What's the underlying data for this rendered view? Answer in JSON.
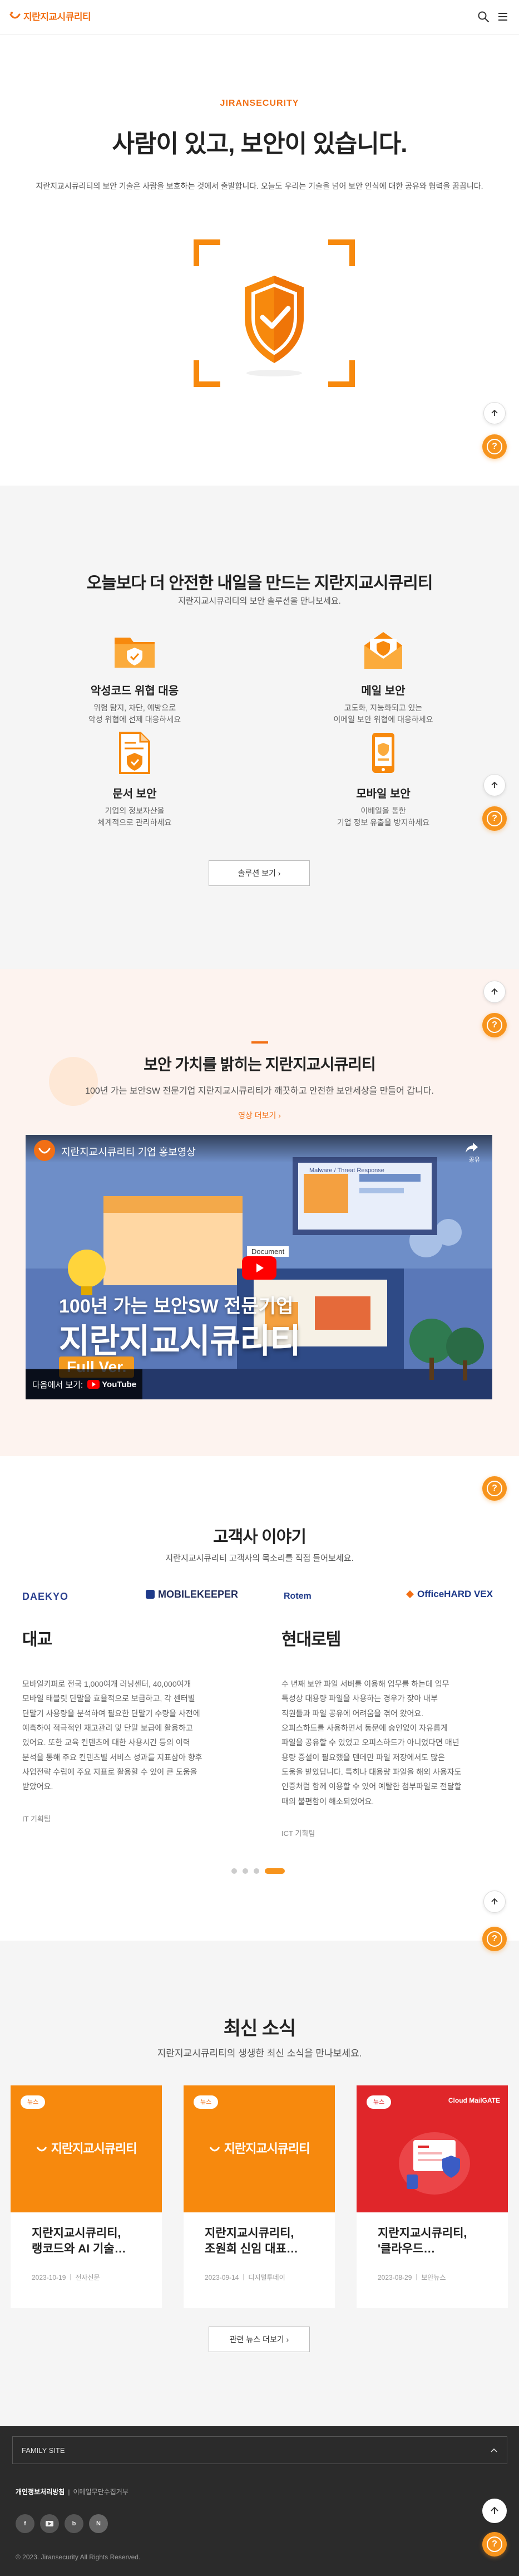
{
  "header": {
    "logo_text": "지란지교시큐리티",
    "search_icon": "search-icon",
    "menu_icon": "hamburger-menu-icon"
  },
  "hero": {
    "eyebrow": "JIRANSECURITY",
    "title": "사람이 있고, 보안이 있습니다.",
    "description": "지란지교시큐리티의 보안 기술은 사람을 보호하는 것에서 출발합니다. 오늘도 우리는 기술을 넘어 보안 인식에 대한 공유와 협력을 꿈꿉니다."
  },
  "solutions": {
    "title": "오늘보다 더 안전한 내일을 만드는 지란지교시큐리티",
    "subtitle": "지란지교시큐리티의 보안 솔루션을 만나보세요.",
    "items": [
      {
        "name": "악성코드 위협 대응",
        "desc1": "위험 탐지, 차단, 예방으로",
        "desc2": "악성 위협에 선제 대응하세요",
        "icon": "malware-folder-icon"
      },
      {
        "name": "메일 보안",
        "desc1": "고도화, 지능화되고 있는",
        "desc2": "이메일 보안 위협에 대응하세요",
        "icon": "mail-security-icon"
      },
      {
        "name": "문서 보안",
        "desc1": "기업의 정보자산을",
        "desc2": "체계적으로 관리하세요",
        "icon": "document-security-icon"
      },
      {
        "name": "모바일 보안",
        "desc1": "이베일을 통한",
        "desc2": "기업 정보 유출을 방지하세요",
        "icon": "mobile-security-icon"
      }
    ],
    "button": "솔루션 보기 ›"
  },
  "value": {
    "title": "보안 가치를 밝히는 지란지교시큐리티",
    "subtitle": "100년 가는 보안SW 전문기업 지란지교시큐리티가 깨끗하고 안전한 보안세상을 만들어 갑니다.",
    "link": "영상 더보기 ›",
    "video": {
      "title": "지란지교시큐리티 기업 홍보영상",
      "headline_small": "100년 가는 보안SW 전문기업",
      "headline_big": "지란지교시큐리티",
      "badge": "Full Ver.",
      "watch_on": "다음에서 보기:",
      "platform": "YouTube",
      "share": "공유",
      "panel_label": "Document",
      "panel_label2": "Malware / Threat Response"
    }
  },
  "customers": {
    "title": "고객사 이야기",
    "subtitle": "지란지교시큐리티 고객사의 목소리를 직접 들어보세요.",
    "logos": [
      "DAEKYO",
      "MOBILEKEEPER",
      "Rotem",
      "OfficeHARD VEX"
    ],
    "cases": [
      {
        "title": "대교",
        "lines": [
          "모바일키퍼로 전국 1,000여개 러닝센터, 40,000여개",
          "모바일 태블릿 단말을 효율적으로 보급하고, 각 센터별",
          "단말기 사용량을 분석하여 필요한 단말기 수량을 사전에",
          "예측하여 적극적인 재고관리 및 단말 보급에 활용하고",
          "있어요. 또한 교육 컨텐츠에 대한 사용시간 등의 이력",
          "분석을 통해 주요 컨텐츠별 서비스 성과를 지표삼아 향후",
          "사업전략 수립에 주요 지표로 활용할 수 있어 큰 도움을",
          "받았어요."
        ],
        "tag": "IT 기획팀"
      },
      {
        "title": "현대로템",
        "lines": [
          "수 년째 보안 파일 서버를 이용해 업무를 하는데 업무",
          "특성상 대용량 파일을 사용하는 경우가 잦아 내부",
          "직원들과 파일 공유에 어려움을 겪어 왔어요.",
          "오피스하드를 사용하면서 동문에 승인없이 자유롭게",
          "파일을 공유할 수 있었고 오피스하드가 아니었다면 매년",
          "용량 증설이 필요했을 텐데만 파일 저장에서도 많은",
          "도움을 받았답니다. 특히나 대용량 파일을 해외 사용자도",
          "인증처럼 함께 이용할 수 있어 예탈한 첨부파일로 전달할",
          "때의 불편함이 해소되었어요."
        ],
        "tag": "ICT 기획팀"
      }
    ]
  },
  "news": {
    "title": "최신 소식",
    "subtitle": "지란지교시큐리티의 생생한 최신 소식을 만나보세요.",
    "cards": [
      {
        "tag": "뉴스",
        "logo": "지란지교시큐리티",
        "title_line1": "지란지교시큐리티,",
        "title_line2": "랭코드와 AI 기술…",
        "date": "2023-10-19",
        "source": "전자신문",
        "theme": "orange"
      },
      {
        "tag": "뉴스",
        "logo": "지란지교시큐리티",
        "title_line1": "지란지교시큐리티,",
        "title_line2": "조원희 신임 대표…",
        "date": "2023-09-14",
        "source": "디지털투데이",
        "theme": "orange"
      },
      {
        "tag": "뉴스",
        "logo": "Cloud MailGATE",
        "title_line1": "지란지교시큐리티,",
        "title_line2": "'클라우드…",
        "date": "2023-08-29",
        "source": "보안뉴스",
        "theme": "red"
      }
    ],
    "button": "관련 뉴스 더보기 ›"
  },
  "footer": {
    "family_site": "FAMILY SITE",
    "privacy": "개인정보처리방침",
    "email_policy": "이메일무단수집거부",
    "sns": [
      "facebook-icon",
      "youtube-icon",
      "blog-icon",
      "naver-icon"
    ],
    "copyright": "© 2023. Jiransecurity All Rights Reserved."
  },
  "colors": {
    "brand_orange": "#f26f14",
    "help_orange": "#f7941d",
    "news_red": "#e0262a"
  }
}
